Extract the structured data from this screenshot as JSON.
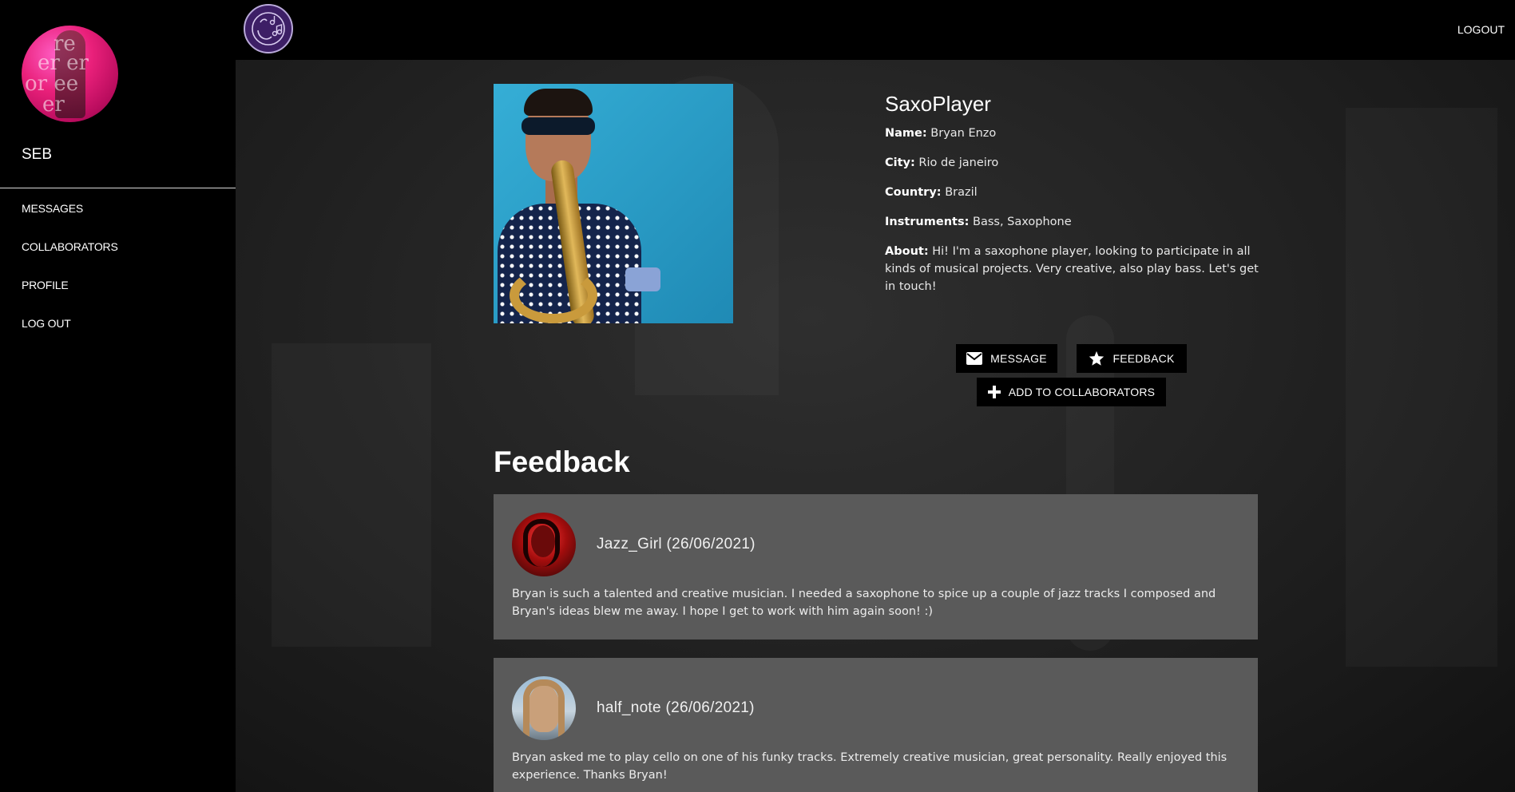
{
  "sidebar": {
    "username": "SEB",
    "nav": [
      {
        "label": "MESSAGES"
      },
      {
        "label": "COLLABORATORS"
      },
      {
        "label": "PROFILE"
      },
      {
        "label": "LOG OUT"
      }
    ]
  },
  "topbar": {
    "logo_icon": "music-notes-icon",
    "logout_label": "LOGOUT"
  },
  "profile": {
    "username": "SaxoPlayer",
    "fields": [
      {
        "label": "Name:",
        "value": "Bryan Enzo"
      },
      {
        "label": "City:",
        "value": "Rio de janeiro"
      },
      {
        "label": "Country:",
        "value": "Brazil"
      },
      {
        "label": "Instruments:",
        "value": "Bass, Saxophone"
      },
      {
        "label": "About:",
        "value": "Hi! I'm a saxophone player, looking to participate in all kinds of musical projects. Very creative, also play bass. Let's get in touch!"
      }
    ],
    "actions": {
      "message_label": "MESSAGE",
      "feedback_label": "FEEDBACK",
      "add_label": "ADD TO COLLABORATORS"
    }
  },
  "feedback": {
    "title": "Feedback",
    "items": [
      {
        "author": "Jazz_Girl (26/06/2021)",
        "text": "Bryan is such a talented and creative musician. I needed a saxophone to spice up a couple of jazz tracks I composed and Bryan's ideas blew me away. I hope I get to work with him again soon! :)"
      },
      {
        "author": "half_note (26/06/2021)",
        "text": "Bryan asked me to play cello on one of his funky tracks. Extremely creative musician, great personality. Really enjoyed this experience. Thanks Bryan!"
      }
    ]
  },
  "colors": {
    "sidebar_bg": "#000000",
    "card_bg": "#5a5a5a",
    "button_bg": "#000000",
    "logo_bg": "#3d1f66"
  }
}
